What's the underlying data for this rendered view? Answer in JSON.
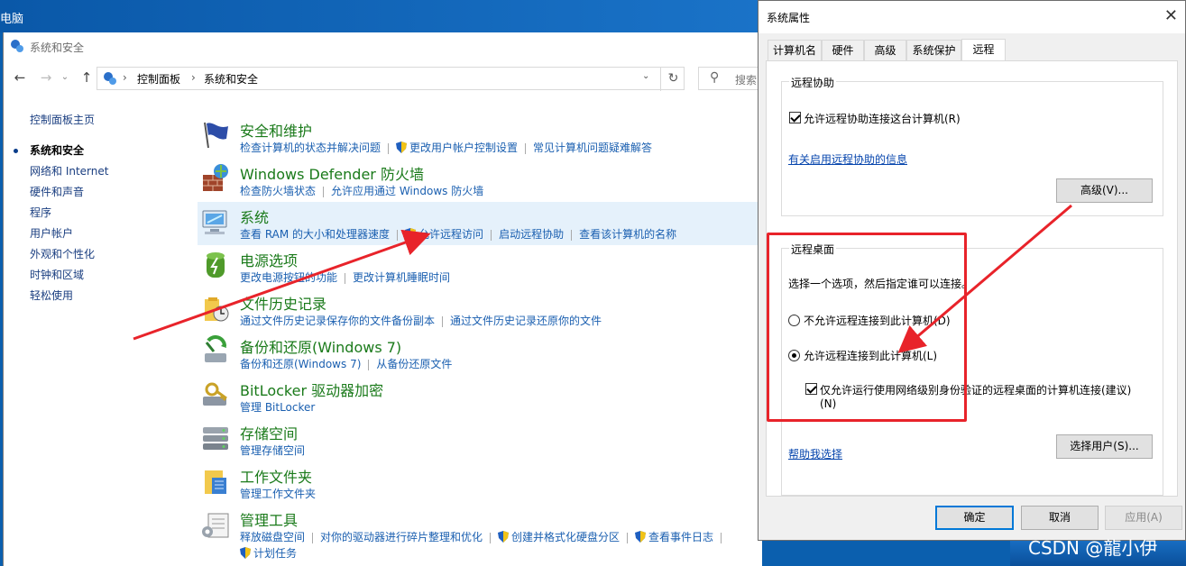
{
  "desktop": {
    "label": "电脑"
  },
  "control_panel": {
    "title": "系统和安全",
    "breadcrumb": [
      "控制面板",
      "系统和安全"
    ],
    "breadcrumb_sep": "›",
    "search_placeholder": "搜索",
    "nav": {
      "back": "←",
      "forward": "→",
      "up": "↑",
      "dropdown": "⌄",
      "refresh": "↻"
    },
    "left_nav": {
      "home": "控制面板主页",
      "items": [
        "系统和安全",
        "网络和 Internet",
        "硬件和声音",
        "程序",
        "用户帐户",
        "外观和个性化",
        "时钟和区域",
        "轻松使用"
      ]
    },
    "categories": [
      {
        "title": "安全和维护",
        "links": [
          "检查计算机的状态并解决问题",
          "更改用户帐户控制设置",
          "常见计算机问题疑难解答"
        ]
      },
      {
        "title": "Windows Defender 防火墙",
        "links": [
          "检查防火墙状态",
          "允许应用通过 Windows 防火墙"
        ]
      },
      {
        "title": "系统",
        "links": [
          "查看 RAM 的大小和处理器速度",
          "允许远程访问",
          "启动远程协助",
          "查看该计算机的名称"
        ]
      },
      {
        "title": "电源选项",
        "links": [
          "更改电源按钮的功能",
          "更改计算机睡眠时间"
        ]
      },
      {
        "title": "文件历史记录",
        "links": [
          "通过文件历史记录保存你的文件备份副本",
          "通过文件历史记录还原你的文件"
        ]
      },
      {
        "title": "备份和还原(Windows 7)",
        "links": [
          "备份和还原(Windows 7)",
          "从备份还原文件"
        ]
      },
      {
        "title": "BitLocker 驱动器加密",
        "links": [
          "管理 BitLocker"
        ]
      },
      {
        "title": "存储空间",
        "links": [
          "管理存储空间"
        ]
      },
      {
        "title": "工作文件夹",
        "links": [
          "管理工作文件夹"
        ]
      },
      {
        "title": "管理工具",
        "links": [
          "释放磁盘空间",
          "对你的驱动器进行碎片整理和优化",
          "创建并格式化硬盘分区",
          "查看事件日志",
          "计划任务"
        ]
      }
    ]
  },
  "dialog": {
    "title": "系统属性",
    "close": "✕",
    "tabs": [
      "计算机名",
      "硬件",
      "高级",
      "系统保护",
      "远程"
    ],
    "remote_assistance": {
      "legend": "远程协助",
      "checkbox_label": "允许远程协助连接这台计算机(R)",
      "link": "有关启用远程协助的信息",
      "advanced_button": "高级(V)..."
    },
    "remote_desktop": {
      "legend": "远程桌面",
      "instruction": "选择一个选项，然后指定谁可以连接。",
      "option_deny": "不允许远程连接到此计算机(D)",
      "option_allow": "允许远程连接到此计算机(L)",
      "nla_label_line1": "仅允许运行使用网络级别身份验证的远程桌面的计算机连接(建议)",
      "nla_label_line2": "(N)",
      "help_link": "帮助我选择",
      "select_users_button": "选择用户(S)..."
    },
    "buttons": {
      "ok": "确定",
      "cancel": "取消",
      "apply": "应用(A)"
    }
  },
  "watermark": "CSDN @龍小伊",
  "colors": {
    "annotation_red": "#e8232a",
    "link_blue": "#1a5fb0",
    "category_green": "#1a7a1a"
  }
}
